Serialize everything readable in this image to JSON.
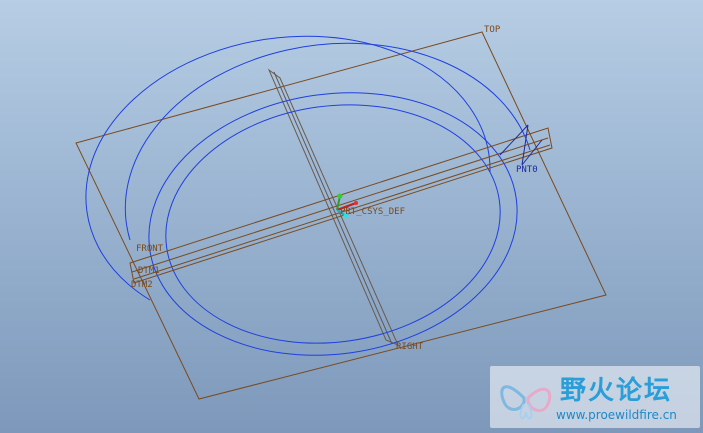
{
  "view": {
    "colors": {
      "background_top": "#b7cde4",
      "background_bottom": "#7d98ba",
      "datum_plane": "#7a4a1e",
      "curves": "#1f3fe0",
      "axis_line": "#5a5a5a"
    },
    "datum_labels": {
      "top": "TOP",
      "front": "FRONT",
      "right": "RIGHT",
      "dtm1": "DTM1",
      "dtm2": "DTM2",
      "pnt0": "PNT0",
      "csys": "PRT_CSYS_DEF"
    }
  },
  "watermark": {
    "title": "野火论坛",
    "url": "www.proewildfire.cn"
  }
}
